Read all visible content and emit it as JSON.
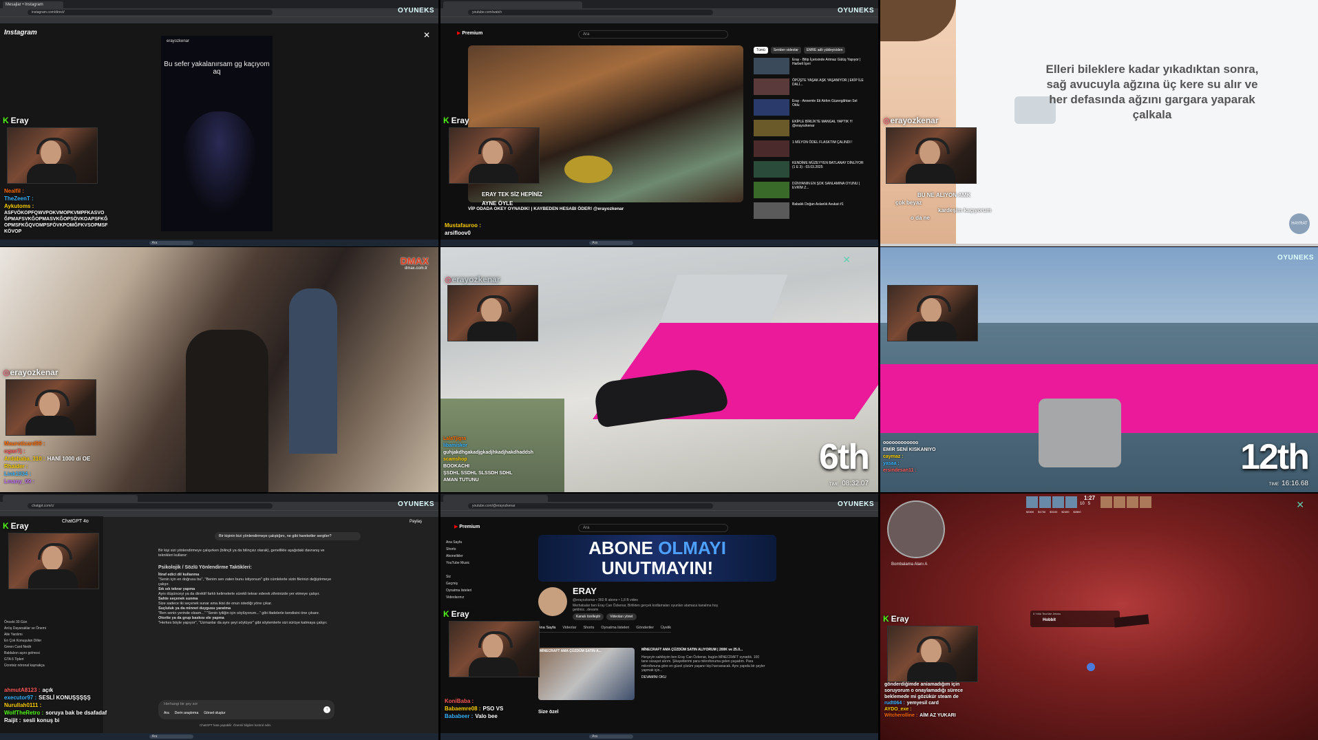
{
  "watermark": "OYUNEKS",
  "streamer_name": "Eray",
  "ig_handle": "erayozkenar",
  "tile1": {
    "tab": "Mesajlar • Instagram",
    "url": "instagram.com/direct/",
    "brand": "Instagram",
    "reel_caption": "Bu sefer yakalanırsam gg kaçıyom aq",
    "reel_user": "erayozkenar",
    "chat": [
      {
        "user": "Nealfil :",
        "msg": "",
        "color": "#ff6a00"
      },
      {
        "user": "TheZeenT :",
        "msg": "",
        "color": "#3ab4ff"
      },
      {
        "user": "Aykutoms :",
        "msg": "",
        "color": "#ffd000"
      },
      {
        "user": "",
        "msg": "ASFVÖKOPFQWVPOKVMOPKVMPFKASVO ĞPMAFSVKĞOPMASVKĞOPSÖVKOAPSFKĞ OPMSFKĞQVOMPSFÖVKPOMĞFKVSOPMSF KÖVOP",
        "color": "#fff"
      }
    ]
  },
  "tile2": {
    "url": "youtube.com/watch",
    "premium": "Premium",
    "search": "Ara",
    "chips": [
      "Tümü",
      "Seriden videolar",
      "EMRE adlı yükleyiciden"
    ],
    "overlay_lines": [
      "ERAY TEK SİZ HEPİNİZ",
      "AYNE ÖYLE",
      "VİP ODADA OKEY OYNADIK! | KAYBEDEN HESABI ÖDER! @erayozkenar"
    ],
    "chat": [
      {
        "user": "Mustafauroo :",
        "msg": "",
        "color": "#ffd000"
      },
      {
        "user": "arsifloov0",
        "msg": "",
        "color": "#fff"
      }
    ],
    "related": [
      "Eray - Bitip İçerisinde Artmaz Gülüş Yapıyor | Harbeli İçeri",
      "ÖPÜŞTE YAŞAK AŞK YAŞANIYOR | EKİP İLE DALİ...",
      "Eray - Annemle Eti Atıfım Güzergâhtan Sel Oldu",
      "EKİPLE BİRLİKTE MANGAL YAPTIK !!! @erayozkenar",
      "1 MİLYON ÖDEL FLASKTIM ÇALINDI !",
      "KENDİME MÜZEYYEN BATLANAY DİNLİYOR (1 E 3) - 03.03.2025",
      "DÜNYANIN EN ŞOK SANLAMINA OYUNU | EVRİM Z...",
      "Babalık Doğan Aslanlık Avukat #1"
    ]
  },
  "tile3": {
    "subtitle": "Elleri bileklere kadar yıkadıktan sonra, sağ avucuyla ağzına üç kere su alır ve her defasında ağzını gargara yaparak çalkala",
    "logo": "HAYRAT",
    "chat": [
      {
        "user": "",
        "msg": "BU NE ALIYON AMK",
        "color": "#fff"
      },
      {
        "user": "",
        "msg": "çok beyaz",
        "color": "#fff"
      },
      {
        "user": "",
        "msg": "kardeşim kaçıyorum",
        "color": "#fff"
      },
      {
        "user": "",
        "msg": "o da ne",
        "color": "#fff"
      }
    ]
  },
  "tile4": {
    "channel_logo": "DMAX",
    "channel_url": "dmax.com.tr",
    "chat": [
      {
        "user": "Mauroticard99 :",
        "msg": "",
        "color": "#ff6a00"
      },
      {
        "user": "ogwr7j :",
        "msg": "",
        "color": "#ff5a5a"
      },
      {
        "user": "Ardababa_310 :",
        "msg": "HANİ 1000 di OE",
        "color": "#ffd000"
      },
      {
        "user": "Rhaider :",
        "msg": "",
        "color": "#ffd000"
      },
      {
        "user": "Link1934 :",
        "msg": "",
        "color": "#3ab4ff"
      },
      {
        "user": "Lmany_09 :",
        "msg": "",
        "color": "#c070ff"
      }
    ]
  },
  "tile5": {
    "place": "6th",
    "time_label": "TIME",
    "time": "08:32.07",
    "chat": [
      {
        "user": "LalaTjigra",
        "msg": "",
        "color": "#ff6a00"
      },
      {
        "user": "libamiskor",
        "msg": "",
        "color": "#3ab4ff"
      },
      {
        "user": "",
        "msg": "guhjakdhgakadjgkadjhkadjhakdhaddsh",
        "color": "#fff"
      },
      {
        "user": "scamshop",
        "msg": "",
        "color": "#ffd000"
      },
      {
        "user": "",
        "msg": "BOOKACHI",
        "color": "#fff"
      },
      {
        "user": "",
        "msg": "ŞSDHL SSDHL SLSSDH SDHL",
        "color": "#fff"
      },
      {
        "user": "",
        "msg": "AMAN TUTUNU",
        "color": "#fff"
      }
    ]
  },
  "tile6": {
    "place": "12th",
    "time_label": "TIME",
    "time": "16:16.68",
    "chat": [
      {
        "user": "",
        "msg": "oooooooooooo",
        "color": "#fff"
      },
      {
        "user": "",
        "msg": "EMİR SENİ KISKANIYO",
        "color": "#fff"
      },
      {
        "user": "caymaz :",
        "msg": "",
        "color": "#ffd000"
      },
      {
        "user": "yasaa :",
        "msg": "",
        "color": "#3ab4ff"
      },
      {
        "user": "ersindesan11 :",
        "msg": "",
        "color": "#ff5a5a"
      }
    ]
  },
  "tile7": {
    "url": "chatgpt.com/c/",
    "app": "ChatGPT 4o",
    "share": "Paylaş",
    "user_prompt": "Bir kişinin bizi yönlendirmeye çalıştığını, ne gibi hareketler sergiler?",
    "intro": "Bir kişi sizi yönlendirmeye çalışırken (bilinçli ya da bilinçsiz olarak), genellikle aşağıdaki davranış ve teknikleri kullanır:",
    "heading": "Psikolojik / Sözlü Yönlendirme Taktikleri:",
    "items": [
      {
        "title": "İtiraf edici dil kullanma",
        "text": "\"Senin için en doğrusu bu\", \"Benim sen zaten bunu istiyorsun\" gibi cümlelerle sizin fikrinizi değiştirmeye çalışır."
      },
      {
        "title": "Sık sık tekrar yapma",
        "text": "Aynı düşünceyi ya da direktif farklı kelimelerle sürekli tekrar ederek zihninizde yer etmeye çalışır."
      },
      {
        "title": "Sahte seçenek sunma",
        "text": "Size sadece iki seçenek sunar ama ikisi de onun istediği yöne çıkar."
      },
      {
        "title": "Suçluluk ya da minnet duygusu yaratma",
        "text": "\"Ben senin yerinde olsam...\" \"Senin iyiliğin için söylüyorum...\" gibi ifadelerle kendisini öne çıkarır."
      },
      {
        "title": "Otorite ya da grup baskısı ele yapma",
        "text": "\"Herkes böyle yapıyor\", \"Uzmanlar da aynı şeyi söylüyor\" gibi söylemlerle sizi sürüye katmaya çalışır."
      }
    ],
    "composer_placeholder": "Herhangi bir şey sor",
    "composer_buttons": [
      "Ara",
      "Derin araştırma",
      "Görsel oluştur"
    ],
    "footer": "ChatGPT hata yapabilir. Önemli bilgileri kontrol edin.",
    "sidebar": [
      "Önceki 30 Gün",
      "Arılış Dayanaklar ve Önemi",
      "Aile Yardımı",
      "En Çok Konuşulan Diller",
      "Green Card Nedir",
      "Baldalıon aşını gelmesi",
      "GTA 6 Tipleri",
      "Ücretsiz nöronal kaynakça"
    ],
    "chat": [
      {
        "user": "ahmutA8123 :",
        "msg": "açık",
        "color": "#ff5a5a"
      },
      {
        "user": "executor97 :",
        "msg": "SESLİ KONUŞŞŞŞŞ",
        "color": "#3ab4ff"
      },
      {
        "user": "Nurullah0111 :",
        "msg": "",
        "color": "#ffd000"
      },
      {
        "user": "WolfTheRetro :",
        "msg": "soruya bak be dsafadaf",
        "color": "#53fc18"
      },
      {
        "user": "Raijit :",
        "msg": "sesli konuş bi",
        "color": "#fff"
      }
    ]
  },
  "tile8": {
    "url": "youtube.com/@erayozkenar",
    "premium": "Premium",
    "search": "Ara",
    "banner_main": "ABONE",
    "banner_accent": "OLMAYI",
    "banner_line2": "UNUTMAYIN!",
    "channel": "ERAY",
    "handle": "@erayozkenar",
    "stats": "360 B abone • 1,8 B video",
    "desc": "Merhabalar ben Eray Can Özkenar, Birlikten gerçek kodlamaları oyunları atamaca kanalına hoş geldiniz...devamı",
    "buttons": [
      "Kanalı özelleştir",
      "Videoları yönet"
    ],
    "tabs": [
      "Ana Sayfa",
      "Videolar",
      "Shorts",
      "Oynatma listeleri",
      "Gönderiler",
      "Üyelik"
    ],
    "feature_title": "MİNECRAFT AMA ÇÜZDÜM SATIN ALIYORUM | 200K ve 25.0...",
    "feature_text": "Herşeyin sahibiyim ben Eray Can Özkenar, bugün MİNECRAFT oynadık. 100 tane süsayet alırım. Şikayetlerimi para mikrofonuma gelen yaşadım. Para mikrofonuna göre en güzel çözüm yaşanır kişi harcanacak. Aynı yapıda bir şeyler yapmak için...",
    "more": "DEVAMINI OKU",
    "feature_thumb": "MİNECRAFT AMA ÇÜZDÜM SATIN A...",
    "section": "Size özel",
    "nav": [
      "Ana Sayfa",
      "Shorts",
      "Abonelikler",
      "YouTube Music",
      "Siz",
      "Geçmiş",
      "Oynatma listeleri",
      "Videolarınız"
    ],
    "chat": [
      {
        "user": "KoniBaba :",
        "msg": "",
        "color": "#ff5a5a"
      },
      {
        "user": "Babaemre08 :",
        "msg": "PSO VS",
        "color": "#ffd000"
      },
      {
        "user": "Bababeer :",
        "msg": "Valo bee",
        "color": "#3ab4ff"
      }
    ]
  },
  "tile9": {
    "hud_time": "1:27",
    "score_left": "10",
    "score_right": "5",
    "money": [
      "$3300",
      "$1700",
      "$3100",
      "$2400",
      "$2800"
    ],
    "radar_label": "Bombalama Alanı A",
    "kill_user": "Hobbit",
    "weapon_tag": "5 Yıllık Tecrübe Jetonu",
    "chat": [
      {
        "user": "",
        "msg": "gönderdiğimde aniamadığım için soruyorum o onaylamadığı sürece beklemede mi gözükür steam de",
        "color": "#fff"
      },
      {
        "user": "rudt064 :",
        "msg": "yemyesil card",
        "color": "#3ab4ff"
      },
      {
        "user": "AYDO_exe :",
        "msg": "",
        "color": "#ffd000"
      },
      {
        "user": "Witcherolline :",
        "msg": "AİM AZ YUKARI",
        "color": "#ff6a00"
      }
    ]
  }
}
